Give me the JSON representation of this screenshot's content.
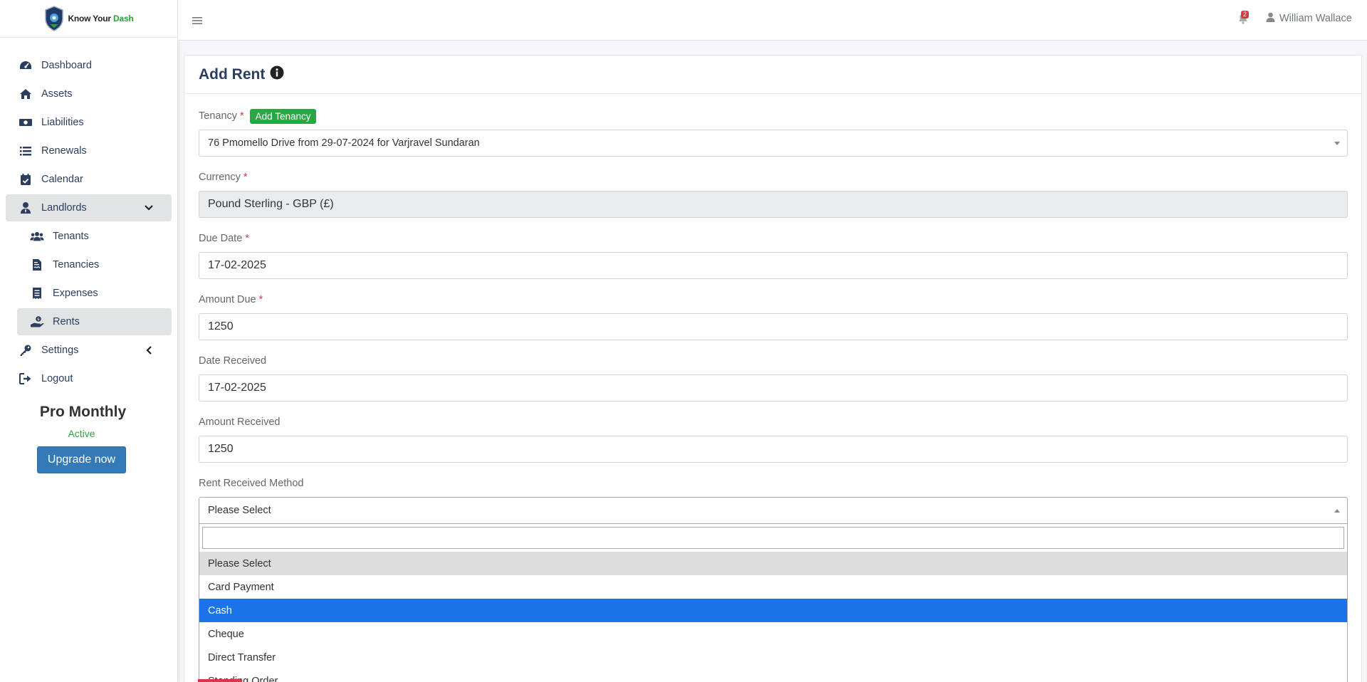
{
  "brand": {
    "name_part1": "Know Your ",
    "name_part2": "Dash",
    "accent_color": "#2e9e3e"
  },
  "sidebar": {
    "items": [
      {
        "label": "Dashboard",
        "icon": "gauge-icon"
      },
      {
        "label": "Assets",
        "icon": "house-icon"
      },
      {
        "label": "Liabilities",
        "icon": "money-bill-icon"
      },
      {
        "label": "Renewals",
        "icon": "list-icon"
      },
      {
        "label": "Calendar",
        "icon": "calendar-check-icon"
      },
      {
        "label": "Landlords",
        "icon": "user-tie-icon",
        "expanded": true
      },
      {
        "label": "Tenants",
        "icon": "users-icon"
      },
      {
        "label": "Tenancies",
        "icon": "file-contract-icon"
      },
      {
        "label": "Expenses",
        "icon": "receipt-icon"
      },
      {
        "label": "Rents",
        "icon": "hand-holding-dollar-icon",
        "active": true
      },
      {
        "label": "Settings",
        "icon": "key-icon"
      },
      {
        "label": "Logout",
        "icon": "sign-out-icon"
      }
    ],
    "plan": {
      "name": "Pro Monthly",
      "status": "Active",
      "upgrade_label": "Upgrade now"
    }
  },
  "topbar": {
    "notification_count": "2",
    "user_name": "William Wallace"
  },
  "form": {
    "title": "Add Rent",
    "tenancy": {
      "label": "Tenancy",
      "add_label": "Add Tenancy",
      "value": "76 Pmomello Drive from 29-07-2024 for Varjravel Sundaran"
    },
    "currency": {
      "label": "Currency",
      "value": "Pound Sterling - GBP (£)"
    },
    "due_date": {
      "label": "Due Date",
      "value": "17-02-2025"
    },
    "amount_due": {
      "label": "Amount Due",
      "value": "1250"
    },
    "date_received": {
      "label": "Date Received",
      "value": "17-02-2025"
    },
    "amount_received": {
      "label": "Amount Received",
      "value": "1250"
    },
    "method": {
      "label": "Rent Received Method",
      "value": "Please Select",
      "search_value": "",
      "options": [
        "Please Select",
        "Card Payment",
        "Cash",
        "Cheque",
        "Direct Transfer",
        "Standing Order"
      ],
      "current_option": "Please Select",
      "highlighted_option": "Cash"
    }
  },
  "colors": {
    "highlight": "#1a73e8",
    "required": "#dc3545",
    "success": "#28a745",
    "primary": "#337ab7"
  }
}
